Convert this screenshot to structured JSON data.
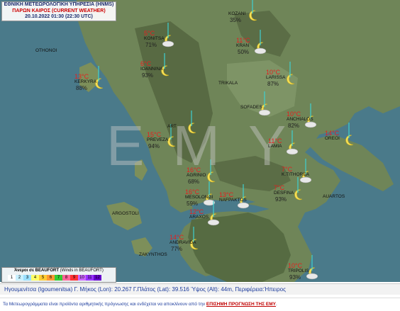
{
  "header": {
    "line1": "ΕΘΝΙΚΗ ΜΕΤΕΩΡΟΛΟΓΙΚΗ ΥΠΗΡΕΣΙΑ (HNMS)",
    "line2": "ΠΑΡΩΝ ΚΑΙΡΟΣ (CURRENT WEATHER)",
    "line3": "20.10.2022 01:30 (22:30 UTC)"
  },
  "watermark": "EMY",
  "colors": {
    "temperature": "#e32020",
    "sea": "#4a7a8a",
    "land": "#6f8558",
    "mountain": "#4f5e3a",
    "wind_barb": "#3fd0d0"
  },
  "places": [
    {
      "name": "OTHONOI"
    },
    {
      "name": "ARGOSTOLI"
    },
    {
      "name": "ZAKYNTHOS"
    },
    {
      "name": "TRIKALA"
    },
    {
      "name": "AUARTOS"
    }
  ],
  "stations": [
    {
      "name": "KOZANI",
      "temp": "",
      "humidity": "35%",
      "icon": "moon-clear"
    },
    {
      "name": "KONITSA",
      "temp": "5°C",
      "humidity": "71%",
      "icon": "moon-cloud"
    },
    {
      "name": "KRAN",
      "temp": "11°C",
      "humidity": "50%",
      "icon": "moon-cloud"
    },
    {
      "name": "IOANNINA",
      "temp": "6°C",
      "humidity": "93%",
      "icon": "moon-clear"
    },
    {
      "name": "KERKYRA",
      "temp": "13°C",
      "humidity": "88%",
      "icon": "moon-clear"
    },
    {
      "name": "LARISSA",
      "temp": "10°C",
      "humidity": "87%",
      "icon": "moon-clear"
    },
    {
      "name": "SOFADES",
      "temp": "",
      "humidity": "",
      "icon": "moon-cloud"
    },
    {
      "name": "ANCHIALOS",
      "temp": "10°C",
      "humidity": "82%",
      "icon": "moon-cloud"
    },
    {
      "name": "ART",
      "temp": "",
      "humidity": "",
      "icon": "moon-clear"
    },
    {
      "name": "PREVEZA",
      "temp": "15°C",
      "humidity": "94%",
      "icon": "moon-clear"
    },
    {
      "name": "LAMIA",
      "temp": "11°C",
      "humidity": "",
      "icon": "moon-cloud"
    },
    {
      "name": "OREOI",
      "temp": "14°C",
      "humidity": "",
      "icon": "moon-clear"
    },
    {
      "name": "AGRINIO",
      "temp": "16°C",
      "humidity": "68%",
      "icon": "moon-clear"
    },
    {
      "name": "K.TITHOREA",
      "temp": "7°C",
      "humidity": "",
      "icon": "moon-cloud"
    },
    {
      "name": "MESOLONGI",
      "temp": "16°C",
      "humidity": "59%",
      "icon": "moon-cloud"
    },
    {
      "name": "NAFPAKTOS",
      "temp": "13°C",
      "humidity": "",
      "icon": "moon-cloud"
    },
    {
      "name": "DESFINA",
      "temp": "7°C",
      "humidity": "93%",
      "icon": "moon-clear"
    },
    {
      "name": "ARAXOS",
      "temp": "12°C",
      "humidity": "",
      "icon": "moon-cloud"
    },
    {
      "name": "ANDRAVIDA",
      "temp": "14°C",
      "humidity": "77%",
      "icon": "moon-clear"
    },
    {
      "name": "TRIPOLIS",
      "temp": "10°C",
      "humidity": "93%",
      "icon": "moon-cloud"
    }
  ],
  "legend": {
    "title_gr": "Άνεμοι σε BEAUFORT",
    "title_en": "(Winds in BEAUFORT)",
    "levels": [
      "1",
      "2",
      "3",
      "4",
      "5",
      "6",
      "7",
      "8",
      "9",
      "10",
      "11",
      "12"
    ],
    "colors": [
      "#ffffff",
      "#c8f0ff",
      "#9be0ff",
      "#ffff66",
      "#ffcc33",
      "#ff9933",
      "#33cc33",
      "#ff6699",
      "#ff3333",
      "#cc66ff",
      "#9933ff",
      "#6600cc"
    ]
  },
  "info": {
    "station_label": "Ηγουμενίτσα (Igoumenitsa)",
    "lon_label": "Γ. Μήκος (Lon):",
    "lon": "20.267",
    "lat_label": "Γ.Πλάτος (Lat):",
    "lat": "39.516",
    "alt_label": "Ύψος (Alt):",
    "alt": "44m,",
    "region_label": "Περιφέρεια:",
    "region": "Ήπειρος"
  },
  "footer": {
    "text": "Τα Μετεωρογράμματα είναι προϊόντα αριθμητικής πρόγνωσης και ενδέχεται να αποκλίνουν από την",
    "link": "ΕΠΙΣΗΜΗ ΠΡΟΓΝΩΣΗ ΤΗΣ ΕΜΥ",
    "end": "."
  }
}
